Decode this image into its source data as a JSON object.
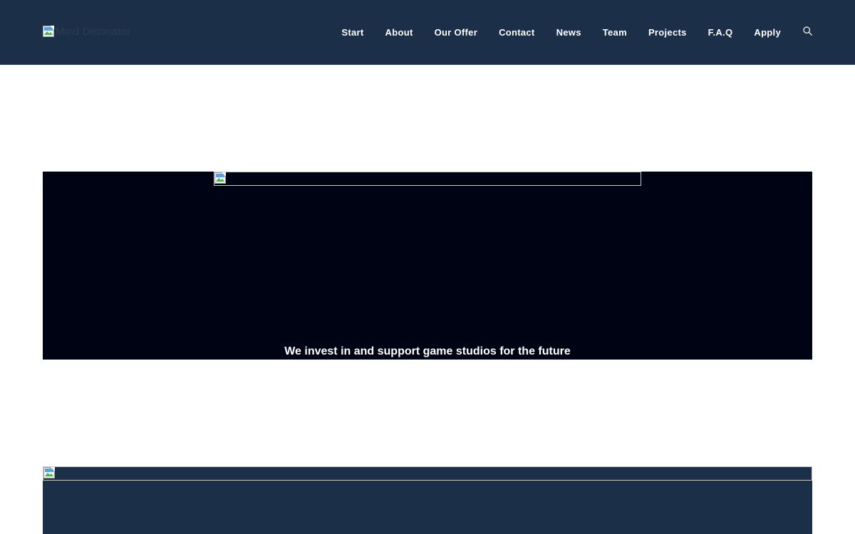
{
  "header": {
    "logo_alt": "Mind Detonator",
    "logo_icon": "broken-image-icon",
    "nav": [
      {
        "label": "Start"
      },
      {
        "label": "About"
      },
      {
        "label": "Our Offer"
      },
      {
        "label": "Contact"
      },
      {
        "label": "News"
      },
      {
        "label": "Team"
      },
      {
        "label": "Projects"
      },
      {
        "label": "F.A.Q"
      },
      {
        "label": "Apply"
      }
    ],
    "search_icon": "search-icon"
  },
  "hero": {
    "image_icon": "broken-image-icon",
    "tagline": "We invest in and support game studios for the future"
  },
  "section_two": {
    "image_icon": "broken-image-icon"
  },
  "colors": {
    "header_bg": "#1b2f48",
    "hero_bg": "#000314",
    "section_bg": "#1b2f48",
    "nav_text": "#ffffff"
  }
}
